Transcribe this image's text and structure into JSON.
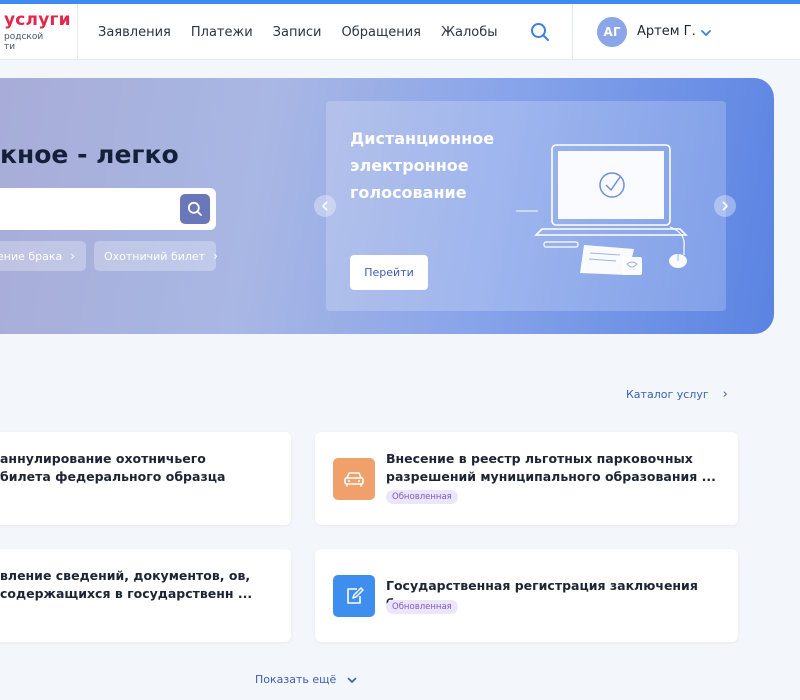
{
  "header": {
    "logo_main": "услуги",
    "logo_sub_line1": "родской",
    "logo_sub_line2": "ти",
    "nav": [
      "Заявления",
      "Платежи",
      "Записи",
      "Обращения",
      "Жалобы"
    ],
    "user_initials": "АГ",
    "user_name": "Артем Г."
  },
  "hero": {
    "title": "кное - легко",
    "chips": [
      "ление брака",
      "Охотничий билет"
    ],
    "promo_title": "Дистанционное электронное голосование",
    "promo_button": "Перейти"
  },
  "services": {
    "catalog_link": "Каталог услуг",
    "cards": [
      {
        "title": "аннулирование охотничьего билета федерального образца",
        "badge": ""
      },
      {
        "title": "Внесение в реестр льготных парковочных разрешений муниципального образования ...",
        "badge": "Обновленная"
      },
      {
        "title": "вление сведений, документов, ов, содержащихся в государственн ...",
        "badge": ""
      },
      {
        "title": "Государственная регистрация заключения брака",
        "badge": "Обновленная"
      }
    ],
    "show_more": "Показать ещё"
  },
  "colors": {
    "accent": "#3d8bf0",
    "brand_red": "#e3274a",
    "car_icon_bg": "#f0a06b",
    "doc_icon_bg": "#3e8ef0"
  }
}
